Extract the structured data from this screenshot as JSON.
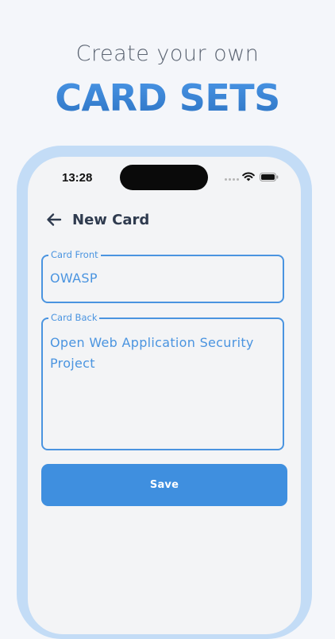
{
  "promo": {
    "subtitle": "Create your own",
    "title": "CARD SETS"
  },
  "status_bar": {
    "time": "13:28"
  },
  "header": {
    "title": "New Card"
  },
  "form": {
    "front": {
      "label": "Card Front",
      "value": "OWASP"
    },
    "back": {
      "label": "Card Back",
      "value": "Open Web Application Security Project"
    },
    "save_label": "Save"
  },
  "icons": {
    "back": "arrow-left-icon",
    "wifi": "wifi-icon",
    "battery": "battery-icon",
    "signal": "signal-dots-icon"
  },
  "colors": {
    "accent": "#3f8fdf",
    "field_border": "#4a94e0",
    "title_text": "#2f3b4f",
    "headline_blue": "#3d86d6",
    "phone_frame": "#c3dcf6",
    "screen_bg": "#f3f4f6",
    "page_bg": "#f4f6fa"
  }
}
